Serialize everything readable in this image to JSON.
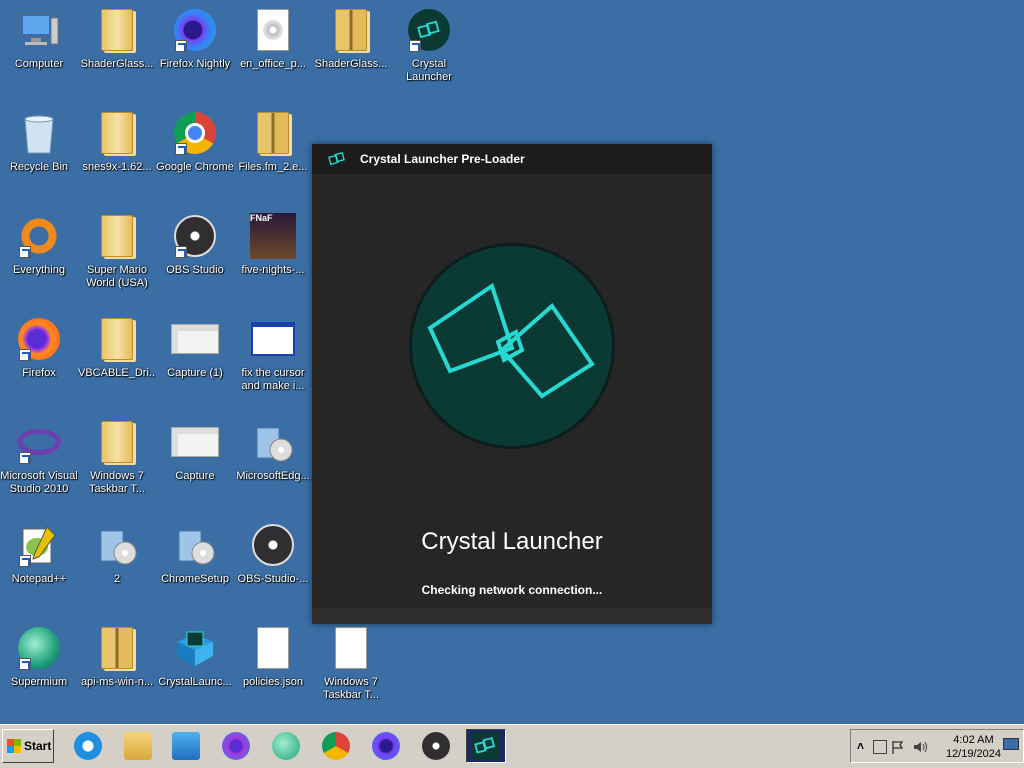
{
  "desktop": {
    "icons": [
      {
        "label": "Computer",
        "icon": "computer-icon"
      },
      {
        "label": "ShaderGlass...",
        "icon": "folder-icon"
      },
      {
        "label": "Firefox Nightly",
        "icon": "firefox-nightly-icon"
      },
      {
        "label": "en_office_p...",
        "icon": "disc-image-icon"
      },
      {
        "label": "ShaderGlass...",
        "icon": "zip-folder-icon"
      },
      {
        "label": "Crystal\nLauncher",
        "icon": "crystal-launcher-icon"
      },
      {
        "label": "Recycle Bin",
        "icon": "recycle-bin-icon"
      },
      {
        "label": "snes9x-1.62...",
        "icon": "folder-icon"
      },
      {
        "label": "Google Chrome",
        "icon": "chrome-icon"
      },
      {
        "label": "Files.fm_2.e...",
        "icon": "zip-folder-icon"
      },
      {
        "label": "Everything",
        "icon": "everything-icon"
      },
      {
        "label": "Super Mario\nWorld (USA)",
        "icon": "folder-icon"
      },
      {
        "label": "OBS Studio",
        "icon": "obs-icon"
      },
      {
        "label": "five-nights-...",
        "icon": "fnaf-image-icon"
      },
      {
        "label": "Firefox",
        "icon": "firefox-icon"
      },
      {
        "label": "VBCABLE_Dri...",
        "icon": "folder-icon"
      },
      {
        "label": "Capture (1)",
        "icon": "image-thumbnail-icon"
      },
      {
        "label": "fix the cursor\nand make i...",
        "icon": "window-thumbnail-icon"
      },
      {
        "label": "Microsoft Visual\nStudio 2010",
        "icon": "visual-studio-icon"
      },
      {
        "label": "Windows 7\nTaskbar T...",
        "icon": "folder-icon"
      },
      {
        "label": "Capture",
        "icon": "image-thumbnail-icon"
      },
      {
        "label": "MicrosoftEdg...",
        "icon": "installer-icon"
      },
      {
        "label": "Notepad++",
        "icon": "notepad-plus-plus-icon"
      },
      {
        "label": "2",
        "icon": "installer-icon"
      },
      {
        "label": "ChromeSetup",
        "icon": "installer-icon"
      },
      {
        "label": "OBS-Studio-...",
        "icon": "obs-installer-icon"
      },
      {
        "label": "Supermium",
        "icon": "supermium-icon"
      },
      {
        "label": "api-ms-win-n...",
        "icon": "zip-folder-icon"
      },
      {
        "label": "CrystalLaunc...",
        "icon": "crystal-package-icon"
      },
      {
        "label": "policies.json",
        "icon": "document-icon"
      },
      {
        "label": "Windows 7\nTaskbar T...",
        "icon": "document-icon"
      }
    ]
  },
  "preloader": {
    "title": "Crystal Launcher Pre-Loader",
    "app_name": "Crystal Launcher",
    "status": "Checking network connection...",
    "accent_color": "#27d9d3",
    "logo_bg_color": "#0b3a35"
  },
  "taskbar": {
    "start_label": "Start",
    "pinned": [
      {
        "icon": "internet-explorer-icon"
      },
      {
        "icon": "file-explorer-icon"
      },
      {
        "icon": "media-player-icon"
      },
      {
        "icon": "firefox-icon"
      },
      {
        "icon": "supermium-icon"
      },
      {
        "icon": "chrome-icon"
      },
      {
        "icon": "firefox-nightly-icon"
      },
      {
        "icon": "obs-icon"
      },
      {
        "icon": "crystal-launcher-icon"
      }
    ],
    "clock": {
      "time": "4:02 AM",
      "date": "12/19/2024"
    },
    "tray_icons": [
      "show-hidden-icons-chevron",
      "network-icon",
      "action-center-flag-icon",
      "volume-icon",
      "show-desktop-icon"
    ]
  }
}
